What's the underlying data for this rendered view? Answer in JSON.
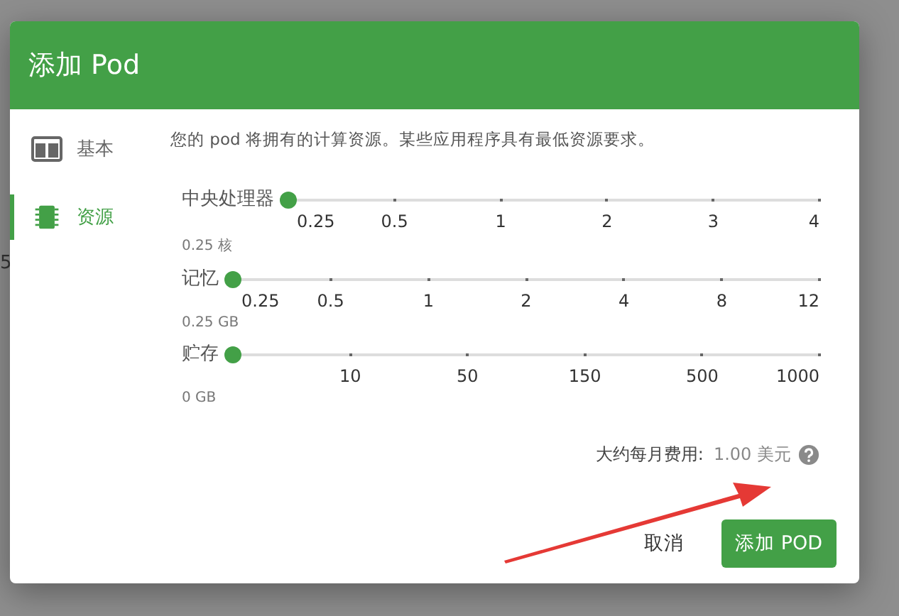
{
  "background_page": {
    "fragment": "5"
  },
  "dialog": {
    "title": "添加 Pod",
    "sidebar": {
      "items": [
        {
          "label": "基本",
          "selected": false
        },
        {
          "label": "资源",
          "selected": true
        }
      ]
    },
    "description": "您的 pod 将拥有的计算资源。某些应用程序具有最低资源要求。",
    "sliders": [
      {
        "label": "中央处理器",
        "reading": "0.25 核",
        "level": 0,
        "marks": [
          "0.25",
          "0.5",
          "1",
          "2",
          "3",
          "4"
        ]
      },
      {
        "label": "记忆",
        "reading": "0.25 GB",
        "level": 0,
        "marks": [
          "0.25",
          "0.5",
          "1",
          "2",
          "4",
          "8",
          "12"
        ]
      },
      {
        "label": "贮存",
        "reading": "0 GB",
        "level": 0,
        "marks": [
          "10",
          "50",
          "150",
          "500",
          "1000"
        ]
      }
    ],
    "cost": {
      "label": "大约每月费用:",
      "value": "1.00 美元"
    },
    "buttons": [
      {
        "label": "取消",
        "kind": "text"
      },
      {
        "label": "添加 POD",
        "kind": "primary"
      }
    ]
  }
}
